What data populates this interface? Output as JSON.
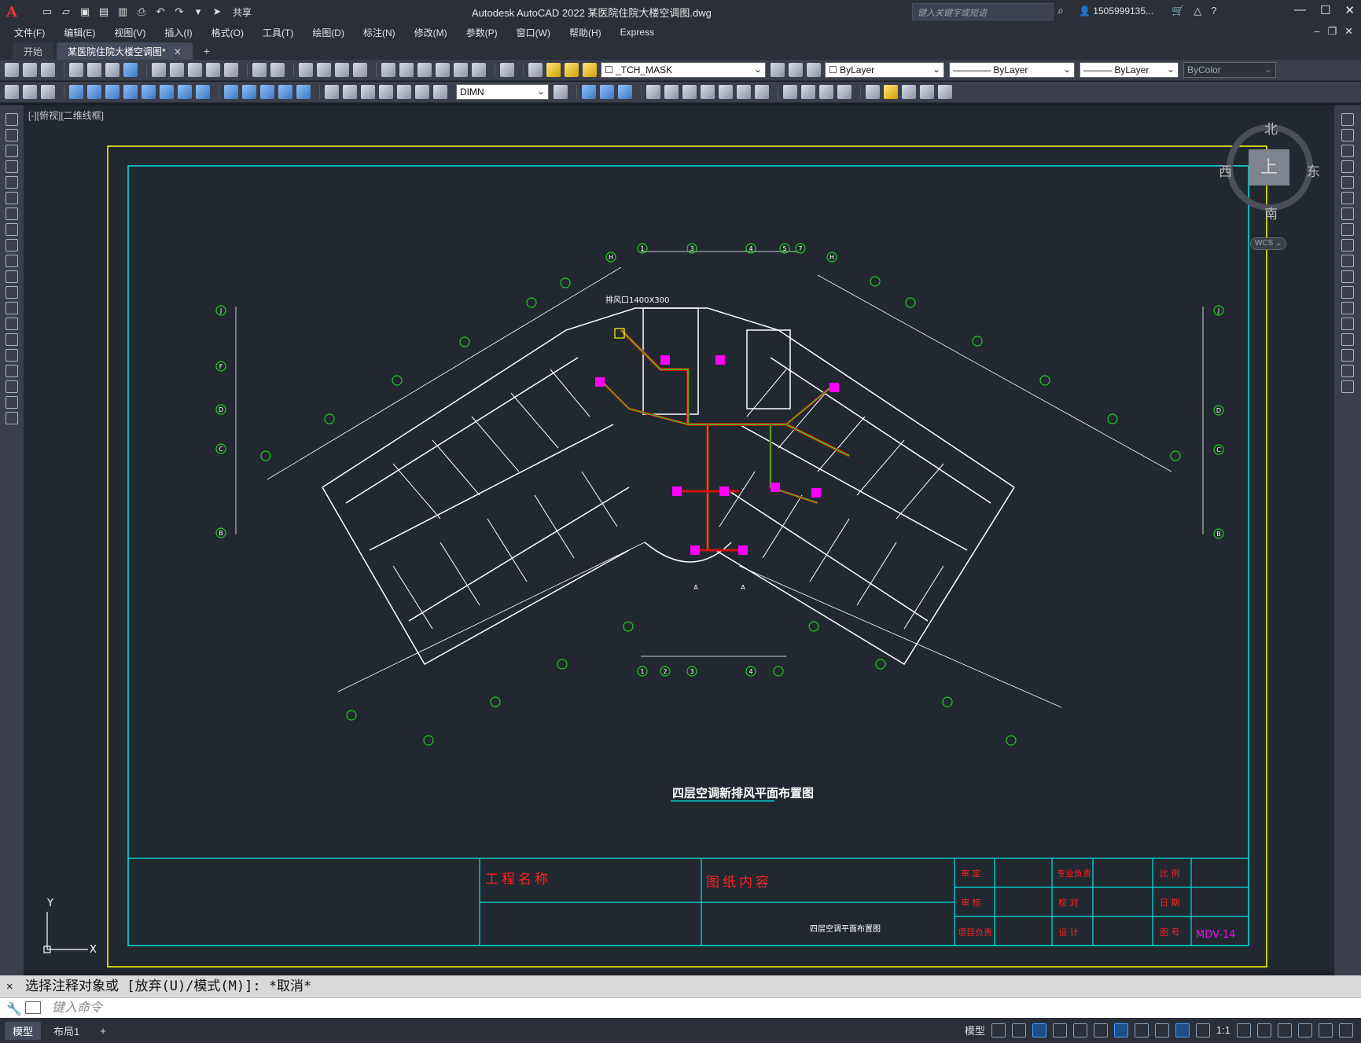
{
  "titlebar": {
    "app_title": "Autodesk AutoCAD 2022   某医院住院大楼空调图.dwg",
    "share_label": "共享",
    "search_placeholder": "键入关键字或短语",
    "user": "1505999135..."
  },
  "menu": [
    "文件(F)",
    "编辑(E)",
    "视图(V)",
    "插入(I)",
    "格式(O)",
    "工具(T)",
    "绘图(D)",
    "标注(N)",
    "修改(M)",
    "参数(P)",
    "窗口(W)",
    "帮助(H)",
    "Express"
  ],
  "tabs": [
    {
      "label": "开始"
    },
    {
      "label": "某医院住院大楼空调图*"
    }
  ],
  "toolbar1": {
    "layer": "_TCH_MASK",
    "color": "ByLayer",
    "linetype": "ByLayer",
    "lineweight": "ByLayer",
    "plotstyle": "ByColor"
  },
  "toolbar2": {
    "dimstyle": "DIMN"
  },
  "viewport_label": "[-][俯视][二维线框]",
  "viewcube": {
    "north": "北",
    "south": "南",
    "west": "西",
    "east": "东",
    "face": "上",
    "wcs": "WCS"
  },
  "drawing": {
    "title": "四层空调新排风平面布置图",
    "project_label": "工程名称",
    "content_label": "图纸内容",
    "content_value": "四层空调平面布置图",
    "tb_cells": [
      "审 定",
      "专业负责",
      "比 例",
      "审 核",
      "校 对",
      "日 期",
      "项目负责",
      "设 计",
      "图 号"
    ],
    "drawing_no": "MDV-14",
    "duct_label": "排风口1400X300",
    "ucs_x": "X",
    "ucs_y": "Y",
    "axis_labels": [
      "1",
      "2",
      "3",
      "4",
      "5",
      "7",
      "J",
      "F",
      "D",
      "C",
      "B",
      "H",
      "A"
    ]
  },
  "command": {
    "history": "选择注释对象或 [放弃(U)/模式(M)]: *取消*",
    "placeholder": "键入命令"
  },
  "status": {
    "layout_tabs": [
      "模型",
      "布局1"
    ],
    "model_label": "模型",
    "scale": "1:1"
  },
  "colors": {
    "canvas": "#212830",
    "frame_yellow": "#ffff00",
    "frame_cyan": "#00e5e5",
    "walls": "#ffffff",
    "grid_bubble": "#22cc22",
    "duct_red": "#d01010",
    "duct_green": "#22dd22",
    "unit_magenta": "#ff00ff",
    "tb_red": "#ff2020"
  }
}
